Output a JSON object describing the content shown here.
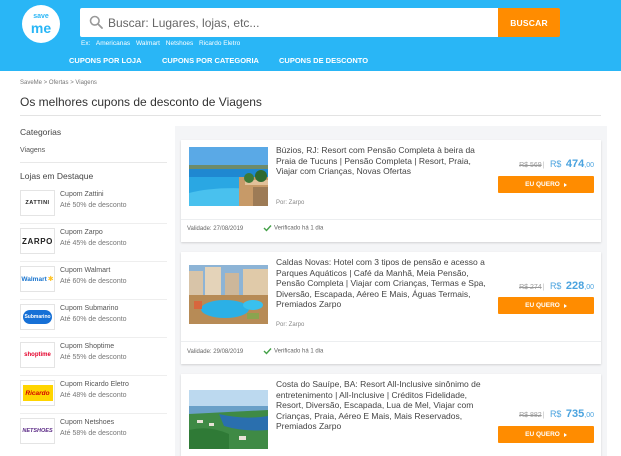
{
  "header": {
    "logo_top": "save",
    "logo_bottom": "me",
    "search_placeholder": "Buscar: Lugares, lojas, etc...",
    "search_button": "BUSCAR",
    "examples_label": "Ex:",
    "examples": [
      "Americanas",
      "Walmart",
      "Netshoes",
      "Ricardo Eletro"
    ],
    "nav": [
      "CUPONS POR LOJA",
      "CUPONS POR CATEGORIA",
      "CUPONS DE DESCONTO"
    ],
    "colors": {
      "primary": "#29b6f6",
      "accent": "#ff8c00"
    }
  },
  "breadcrumb": "SaveMe > Ofertas > Viagens",
  "page_title": "Os melhores cupons de desconto de Viagens",
  "sidebar": {
    "categories_heading": "Categorias",
    "category": "Viagens",
    "stores_heading": "Lojas em Destaque",
    "stores": [
      {
        "name": "Cupom Zattini",
        "desc": "Até 50% de desconto",
        "logo": "ZATTINI"
      },
      {
        "name": "Cupom Zarpo",
        "desc": "Até 45% de desconto",
        "logo": "ZARPO"
      },
      {
        "name": "Cupom Walmart",
        "desc": "Até 60% de desconto",
        "logo": "Walmart"
      },
      {
        "name": "Cupom Submarino",
        "desc": "Até 60% de desconto",
        "logo": "Submarino"
      },
      {
        "name": "Cupom Shoptime",
        "desc": "Até 55% de desconto",
        "logo": "shoptime"
      },
      {
        "name": "Cupom Ricardo Eletro",
        "desc": "Até 48% de desconto",
        "logo": "Ricardo"
      },
      {
        "name": "Cupom Netshoes",
        "desc": "Até 58% de desconto",
        "logo": "NETSHOES"
      }
    ]
  },
  "offers": [
    {
      "title": "Búzios, RJ: Resort com Pensão Completa à beira da Praia de Tucuns | Pensão Completa | Resort, Praia, Viajar com Crianças, Novas Ofertas",
      "by": "Por: Zarpo",
      "old_price": "R$ 569",
      "currency": "R$",
      "price": "474",
      "cents": ",00",
      "cta": "EU QUERO",
      "validity": "Validade: 27/08/2019",
      "verified": "Verificado há 1 dia"
    },
    {
      "title": "Caldas Novas: Hotel com 3 tipos de pensão e acesso a Parques Aquáticos | Café da Manhã, Meia Pensão, Pensão Completa | Viajar com Crianças, Termas e Spa, Diversão, Escapada, Aéreo E Mais, Águas Termais, Premiados Zarpo",
      "by": "Por: Zarpo",
      "old_price": "R$ 274",
      "currency": "R$",
      "price": "228",
      "cents": ",00",
      "cta": "EU QUERO",
      "validity": "Validade: 29/08/2019",
      "verified": "Verificado há 1 dia"
    },
    {
      "title": "Costa do Sauípe, BA: Resort All-Inclusive sinônimo de entretenimento | All-Inclusive | Créditos Fidelidade, Resort, Diversão, Escapada, Lua de Mel, Viajar com Crianças, Praia, Aéreo E Mais, Mais Reservados, Premiados Zarpo",
      "old_price": "R$ 882",
      "currency": "R$",
      "price": "735",
      "cents": ",00",
      "cta": "EU QUERO"
    }
  ]
}
